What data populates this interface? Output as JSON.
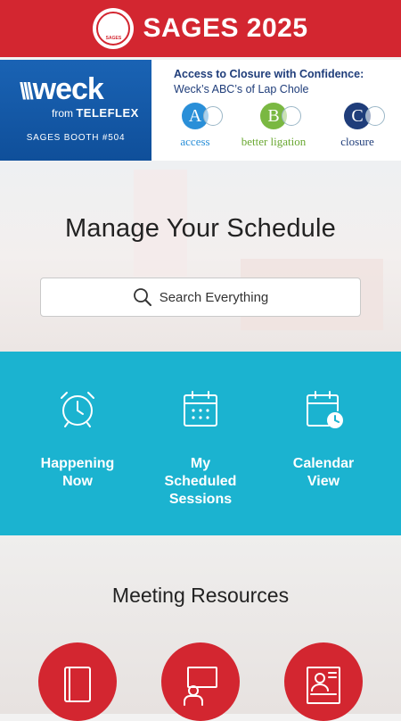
{
  "header": {
    "title": "SAGES 2025",
    "logo": "sages-seal-logo",
    "color": "#d32630"
  },
  "banner": {
    "brand": "weck",
    "brand_from": "from",
    "brand_company": "TELEFLEX",
    "booth": "SAGES BOOTH #504",
    "headline": "Access to Closure with Confidence:",
    "subheadline": "Weck’s ABC’s of Lap Chole",
    "steps": [
      {
        "letter": "A",
        "label": "access",
        "color": "#2a8fd8"
      },
      {
        "letter": "B",
        "label": "better ligation",
        "color": "#7ab842"
      },
      {
        "letter": "C",
        "label": "closure",
        "color": "#1f3d7a"
      }
    ]
  },
  "hero": {
    "title": "Manage Your Schedule",
    "search_placeholder": "Search Everything"
  },
  "quick_links": [
    {
      "label_line1": "Happening",
      "label_line2": "Now",
      "icon": "alarm-clock-icon"
    },
    {
      "label_line1": "My",
      "label_line2": "Scheduled",
      "label_line3": "Sessions",
      "icon": "calendar-grid-icon"
    },
    {
      "label_line1": "Calendar",
      "label_line2": "View",
      "icon": "calendar-clock-icon"
    }
  ],
  "resources": {
    "title": "Meeting Resources",
    "items": [
      {
        "icon": "book-icon"
      },
      {
        "icon": "presenter-screen-icon"
      },
      {
        "icon": "poster-board-icon"
      }
    ]
  },
  "colors": {
    "accent_teal": "#1bb3d0",
    "brand_red": "#d32630"
  }
}
